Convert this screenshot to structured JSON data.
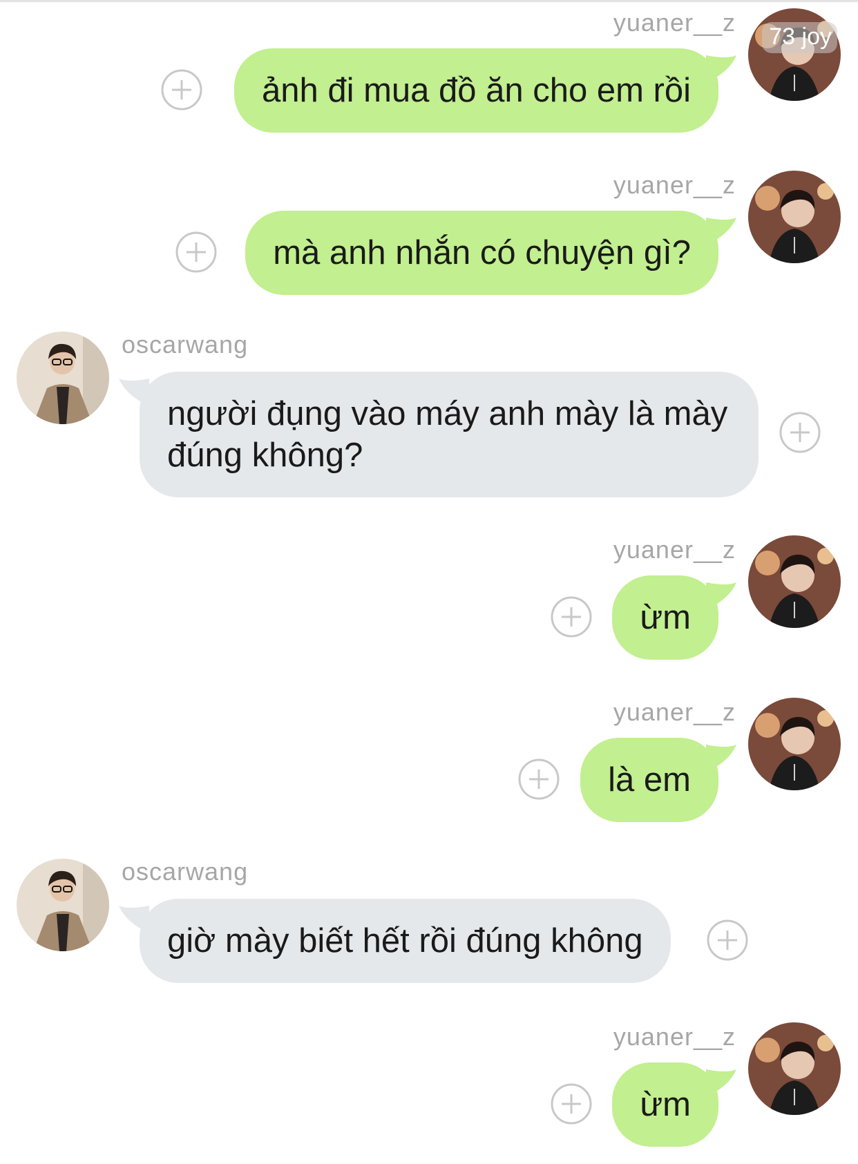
{
  "overlay_badge": "73 joy",
  "messages": [
    {
      "user": "yuaner__z",
      "text": "ảnh đi mua đồ ăn cho em rồi",
      "side": "right"
    },
    {
      "user": "yuaner__z",
      "text": "mà anh nhắn có chuyện gì?",
      "side": "right"
    },
    {
      "user": "oscarwang",
      "text": "người đụng vào máy anh mày là mày đúng không?",
      "side": "left"
    },
    {
      "user": "yuaner__z",
      "text": "ừm",
      "side": "right"
    },
    {
      "user": "yuaner__z",
      "text": "là em",
      "side": "right"
    },
    {
      "user": "oscarwang",
      "text": "giờ mày biết hết rồi đúng không",
      "side": "left"
    },
    {
      "user": "yuaner__z",
      "text": "ừm",
      "side": "right"
    }
  ],
  "colors": {
    "outgoing_bubble": "#c2ef8f",
    "incoming_bubble": "#e5e8eb",
    "username": "#a6a6a6",
    "plus_icon": "#c8c8c8"
  }
}
